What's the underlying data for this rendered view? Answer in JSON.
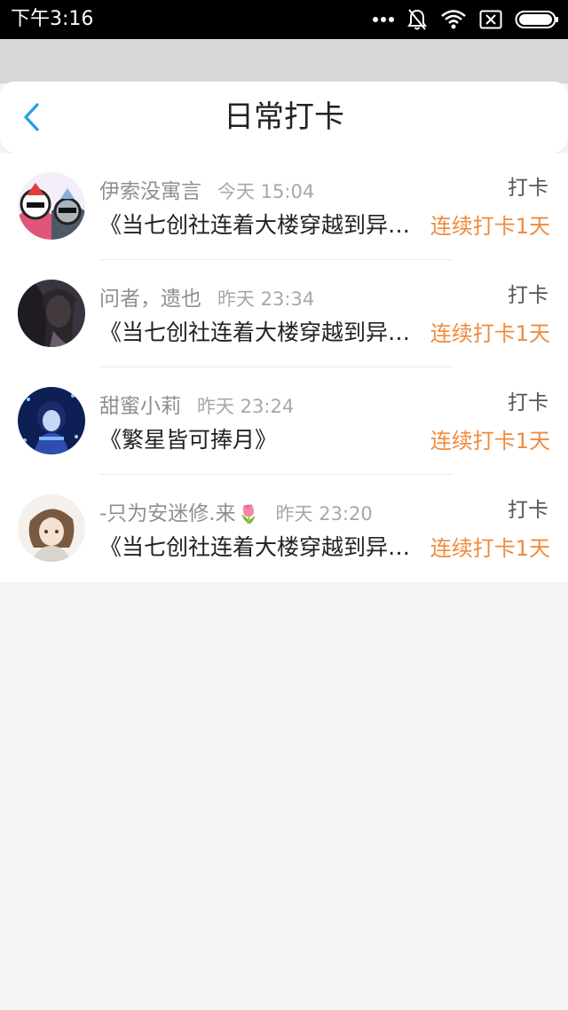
{
  "status_bar": {
    "time": "下午3:16",
    "icons": [
      "more-dots-icon",
      "bell-off-icon",
      "wifi-icon",
      "sim-x-icon",
      "battery-icon"
    ]
  },
  "header": {
    "title": "日常打卡",
    "back_icon": "chevron-left-icon"
  },
  "colors": {
    "accent_blue": "#2a9be8",
    "streak_orange": "#f08a3c",
    "background": "#f4f4f4"
  },
  "items": [
    {
      "name": "伊索没寓言",
      "time": "今天 15:04",
      "work": "《当七创社连着大楼穿越到异界》",
      "action": "打卡",
      "streak": "连续打卡1天"
    },
    {
      "name": "问者，遗也",
      "time": "昨天 23:34",
      "work": "《当七创社连着大楼穿越到异界》",
      "action": "打卡",
      "streak": "连续打卡1天"
    },
    {
      "name": "甜蜜小莉",
      "time": "昨天 23:24",
      "work": "《繁星皆可捧月》",
      "action": "打卡",
      "streak": "连续打卡1天"
    },
    {
      "name": "-只为安迷修.来",
      "name_suffix": "🌷",
      "time": "昨天 23:20",
      "work": "《当七创社连着大楼穿越到异界》",
      "action": "打卡",
      "streak": "连续打卡1天"
    }
  ]
}
